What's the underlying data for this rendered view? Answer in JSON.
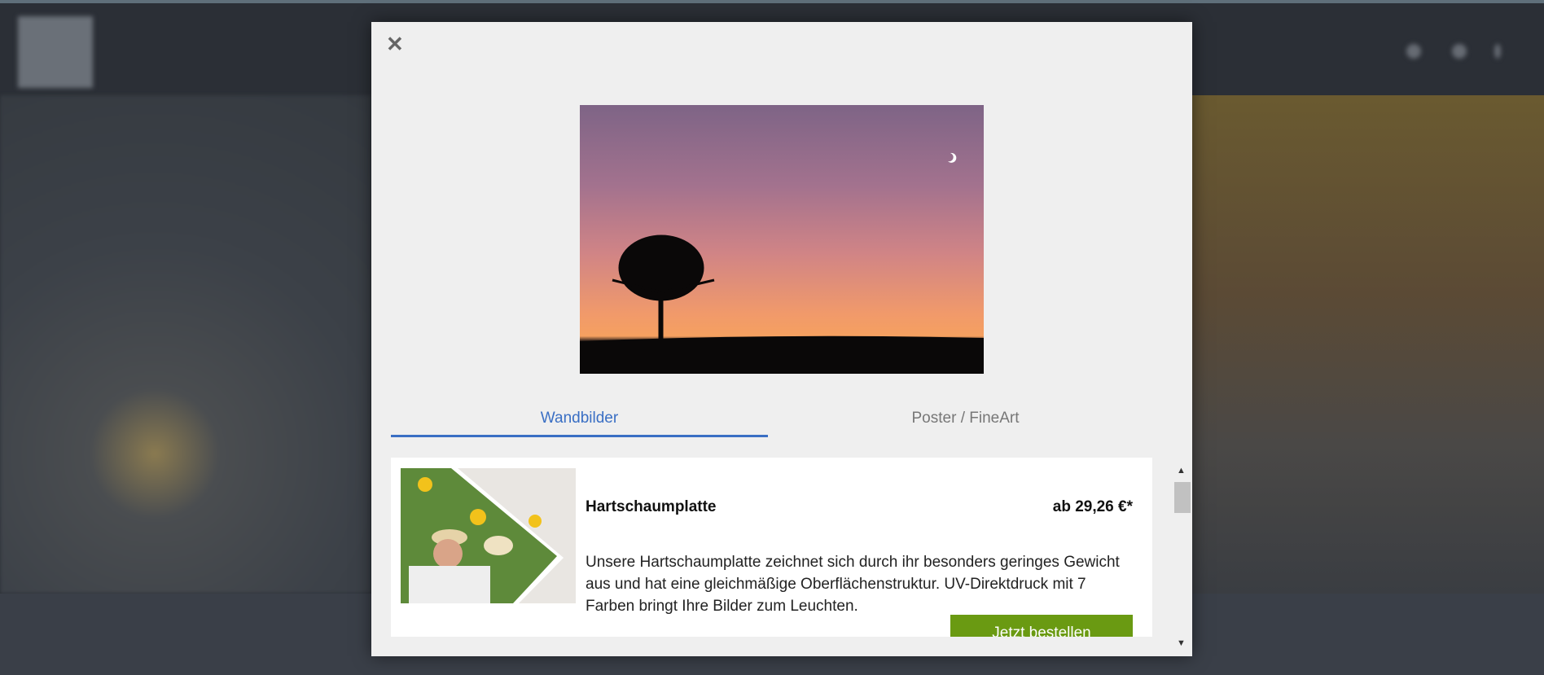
{
  "modal": {
    "close_label": "✕",
    "tabs": [
      {
        "label": "Wandbilder",
        "active": true
      },
      {
        "label": "Poster / FineArt",
        "active": false
      }
    ],
    "products": [
      {
        "title": "Hartschaumplatte",
        "price": "ab 29,26 €*",
        "description": "Unsere Hartschaumplatte zeichnet sich durch ihr besonders geringes Gewicht aus und hat eine gleichmäßige Oberflächenstruktur. UV-Direktdruck mit 7 Farben bringt Ihre Bilder zum Leuchten.",
        "button_label": "Jetzt bestellen"
      }
    ]
  },
  "colors": {
    "accent": "#3a6fc4",
    "order_button": "#6a9a12"
  }
}
